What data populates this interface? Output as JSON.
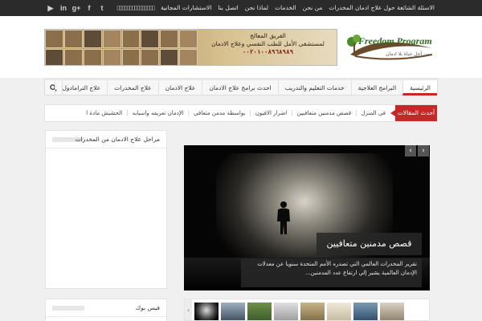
{
  "topbar": {
    "social": [
      "youtube",
      "in",
      "g+",
      "f",
      "t"
    ],
    "social_icons": [
      "youtube-icon",
      "linkedin-icon",
      "google-plus-icon",
      "facebook-icon",
      "twitter-icon"
    ],
    "nav": [
      "الاسئلة الشائعة حول علاج ادمان المخدرات",
      "من نحن",
      "الخدمات",
      "لماذا نحن",
      "اتصل بنا",
      "الاستشارات المجانية",
      "▯▯▯▯▯▯▯▯▯▯▯▯▯▯▯"
    ]
  },
  "header": {
    "logo_text": "Freedom Program",
    "logo_sub": "من أجل حياة بلا ادمان",
    "banner_line1": "الفريق المعالج",
    "banner_line2": "لمستشفى الأمل للطب النفسي وعلاج الادمان",
    "banner_phone": "٠٠٢٠١٠٠٨٩٦٨٩٨٩"
  },
  "mainnav": {
    "items": [
      "الرئيسية",
      "البرامج العلاجية",
      "خدمات التعليم والتدريب",
      "احدث برامج علاج الادمان",
      "علاج الادمان",
      "علاج المخدرات",
      "علاج الترامادول"
    ]
  },
  "ticker": {
    "label": "أحدث المقالات",
    "items": [
      "في المنزل",
      "قصص مدمنين متعافيين",
      "اضرار الافيون",
      "بواسطة مدمن متعافي",
      "الإدمان تعريفه واسبابه",
      "الحشيش مادة ا"
    ]
  },
  "sidebar": {
    "widget1_title": "مراحل علاج الادمان من المخدرات",
    "widget2_title": "فيس بوك"
  },
  "slider": {
    "title": "قصص مدمنين متعافيين",
    "excerpt": "تقرير المخدرات العالمي التي تصدره الأمم المتحدة سنويا عن معدلات الإدمان العالمية يشير إلي ارتفاع عدد المدمنين...",
    "prev": "‹",
    "next": "›"
  },
  "colors": {
    "accent": "#c62828",
    "topbar": "#2b2b2b"
  }
}
